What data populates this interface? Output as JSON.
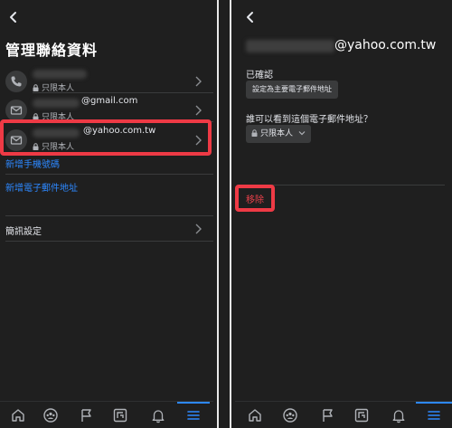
{
  "left": {
    "title": "管理聯絡資料",
    "contacts": [
      {
        "icon": "phone-icon",
        "value": "",
        "privacy": "只限本人"
      },
      {
        "icon": "mail-icon",
        "value": "@gmail.com",
        "privacy": "只限本人"
      },
      {
        "icon": "mail-icon",
        "value": "@yahoo.com.tw",
        "privacy": "只限本人"
      }
    ],
    "add_phone": "新增手機號碼",
    "add_email": "新增電子郵件地址",
    "notification_settings": "簡訊設定"
  },
  "right": {
    "email": "@yahoo.com.tw",
    "confirmed_label": "已確認",
    "set_primary_button": "設定為主要電子郵件地址",
    "who_can_see": "誰可以看到這個電子郵件地址？",
    "privacy_value": "只限本人",
    "remove_label": "移除"
  },
  "bottom_nav": [
    "home-icon",
    "groups-icon",
    "flag-icon",
    "gaming-icon",
    "bell-icon",
    "menu-icon"
  ],
  "colors": {
    "background": "#1f1f1f",
    "accent": "#2d88ff",
    "highlight": "#ee3a45",
    "text": "#e4e6eb",
    "secondary_text": "#b0b3b8"
  }
}
